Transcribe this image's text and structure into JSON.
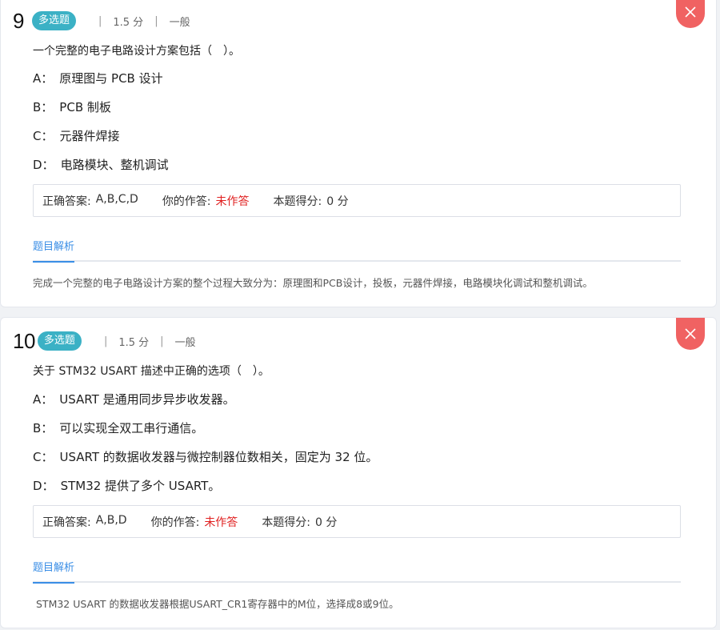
{
  "questions": [
    {
      "number": "9",
      "type_badge": "多选题",
      "score": "1.5 分",
      "difficulty": "一般",
      "separator": "|",
      "stem": "一个完整的电子电路设计方案包括（　）。",
      "options": [
        {
          "letter": "A：",
          "text": "原理图与 PCB 设计"
        },
        {
          "letter": "B：",
          "text": "PCB 制板"
        },
        {
          "letter": "C：",
          "text": "元器件焊接"
        },
        {
          "letter": "D：",
          "text": "电路模块、整机调试"
        }
      ],
      "correct_label": "正确答案:",
      "correct_value": "A,B,C,D",
      "yours_label": "你的作答:",
      "yours_value": "未作答",
      "score_label": "本题得分:",
      "score_value": "0 分",
      "analysis_tab": "题目解析",
      "analysis_text": "完成一个完整的电子电路设计方案的整个过程大致分为：原理图和PCB设计，投板，元器件焊接，电路模块化调试和整机调试。"
    },
    {
      "number": "10",
      "type_badge": "多选题",
      "score": "1.5 分",
      "difficulty": "一般",
      "separator": "|",
      "stem": "关于 STM32 USART 描述中正确的选项（　）。",
      "options": [
        {
          "letter": "A：",
          "text": "USART 是通用同步异步收发器。"
        },
        {
          "letter": "B：",
          "text": "可以实现全双工串行通信。"
        },
        {
          "letter": "C：",
          "text": "USART 的数据收发器与微控制器位数相关，固定为 32 位。"
        },
        {
          "letter": "D：",
          "text": "STM32 提供了多个 USART。"
        }
      ],
      "correct_label": "正确答案:",
      "correct_value": "A,B,D",
      "yours_label": "你的作答:",
      "yours_value": "未作答",
      "score_label": "本题得分:",
      "score_value": "0 分",
      "analysis_tab": "题目解析",
      "analysis_text": "STM32 USART 的数据收发器根据USART_CR1寄存器中的M位，选择成8或9位。"
    }
  ],
  "colors": {
    "badge": "#3bb1c5",
    "close_button": "#f06262",
    "unanswered": "#e02020",
    "tab_active": "#3a8ee6"
  },
  "icons": {
    "close": "close-icon"
  }
}
